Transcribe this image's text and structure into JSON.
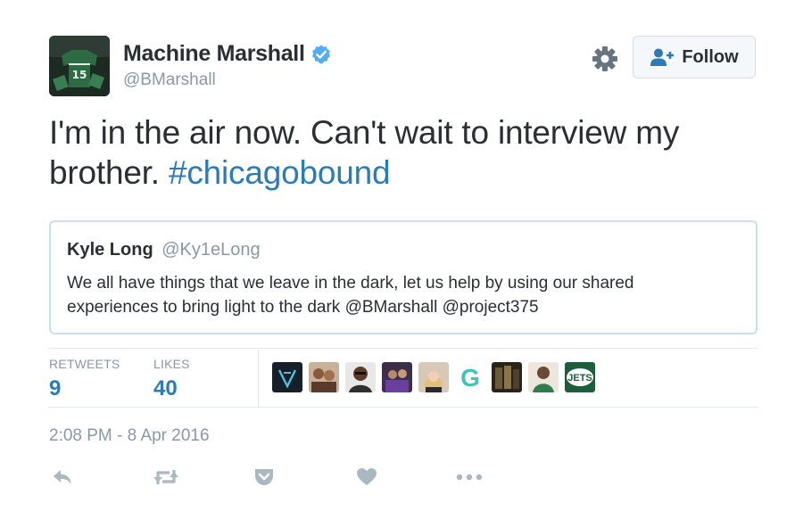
{
  "author": {
    "display_name": "Machine Marshall",
    "handle": "@BMarshall",
    "verified": true,
    "avatar_jersey_number": "15"
  },
  "header": {
    "settings_icon": "gear-icon",
    "follow_label": "Follow"
  },
  "tweet": {
    "text_before": "I'm in the air now. Can't wait to interview  my brother. ",
    "hashtag": "#chicagobound"
  },
  "quote": {
    "name": "Kyle Long",
    "handle": "@Ky1eLong",
    "text": "We all have things that we leave in the dark, let us help by using our shared experiences to bring light to the dark @BMarshall @project375"
  },
  "stats": {
    "retweets_label": "RETWEETS",
    "retweets_value": "9",
    "likes_label": "LIKES",
    "likes_value": "40"
  },
  "likers": [
    {
      "name": "liker-avatar-1"
    },
    {
      "name": "liker-avatar-2"
    },
    {
      "name": "liker-avatar-3"
    },
    {
      "name": "liker-avatar-4"
    },
    {
      "name": "liker-avatar-5"
    },
    {
      "name": "liker-avatar-6",
      "letter": "G"
    },
    {
      "name": "liker-avatar-7"
    },
    {
      "name": "liker-avatar-8"
    },
    {
      "name": "liker-avatar-9",
      "text": "JETS"
    }
  ],
  "timestamp": "2:08 PM - 8 Apr 2016",
  "actions": [
    "reply-icon",
    "retweet-icon",
    "pocket-icon",
    "heart-icon",
    "more-icon"
  ],
  "colors": {
    "link": "#2b7bb9",
    "secondary_text": "#8899a6",
    "primary_text": "#292f33",
    "verified": "#55acee",
    "action_icon": "#aab8c2"
  }
}
